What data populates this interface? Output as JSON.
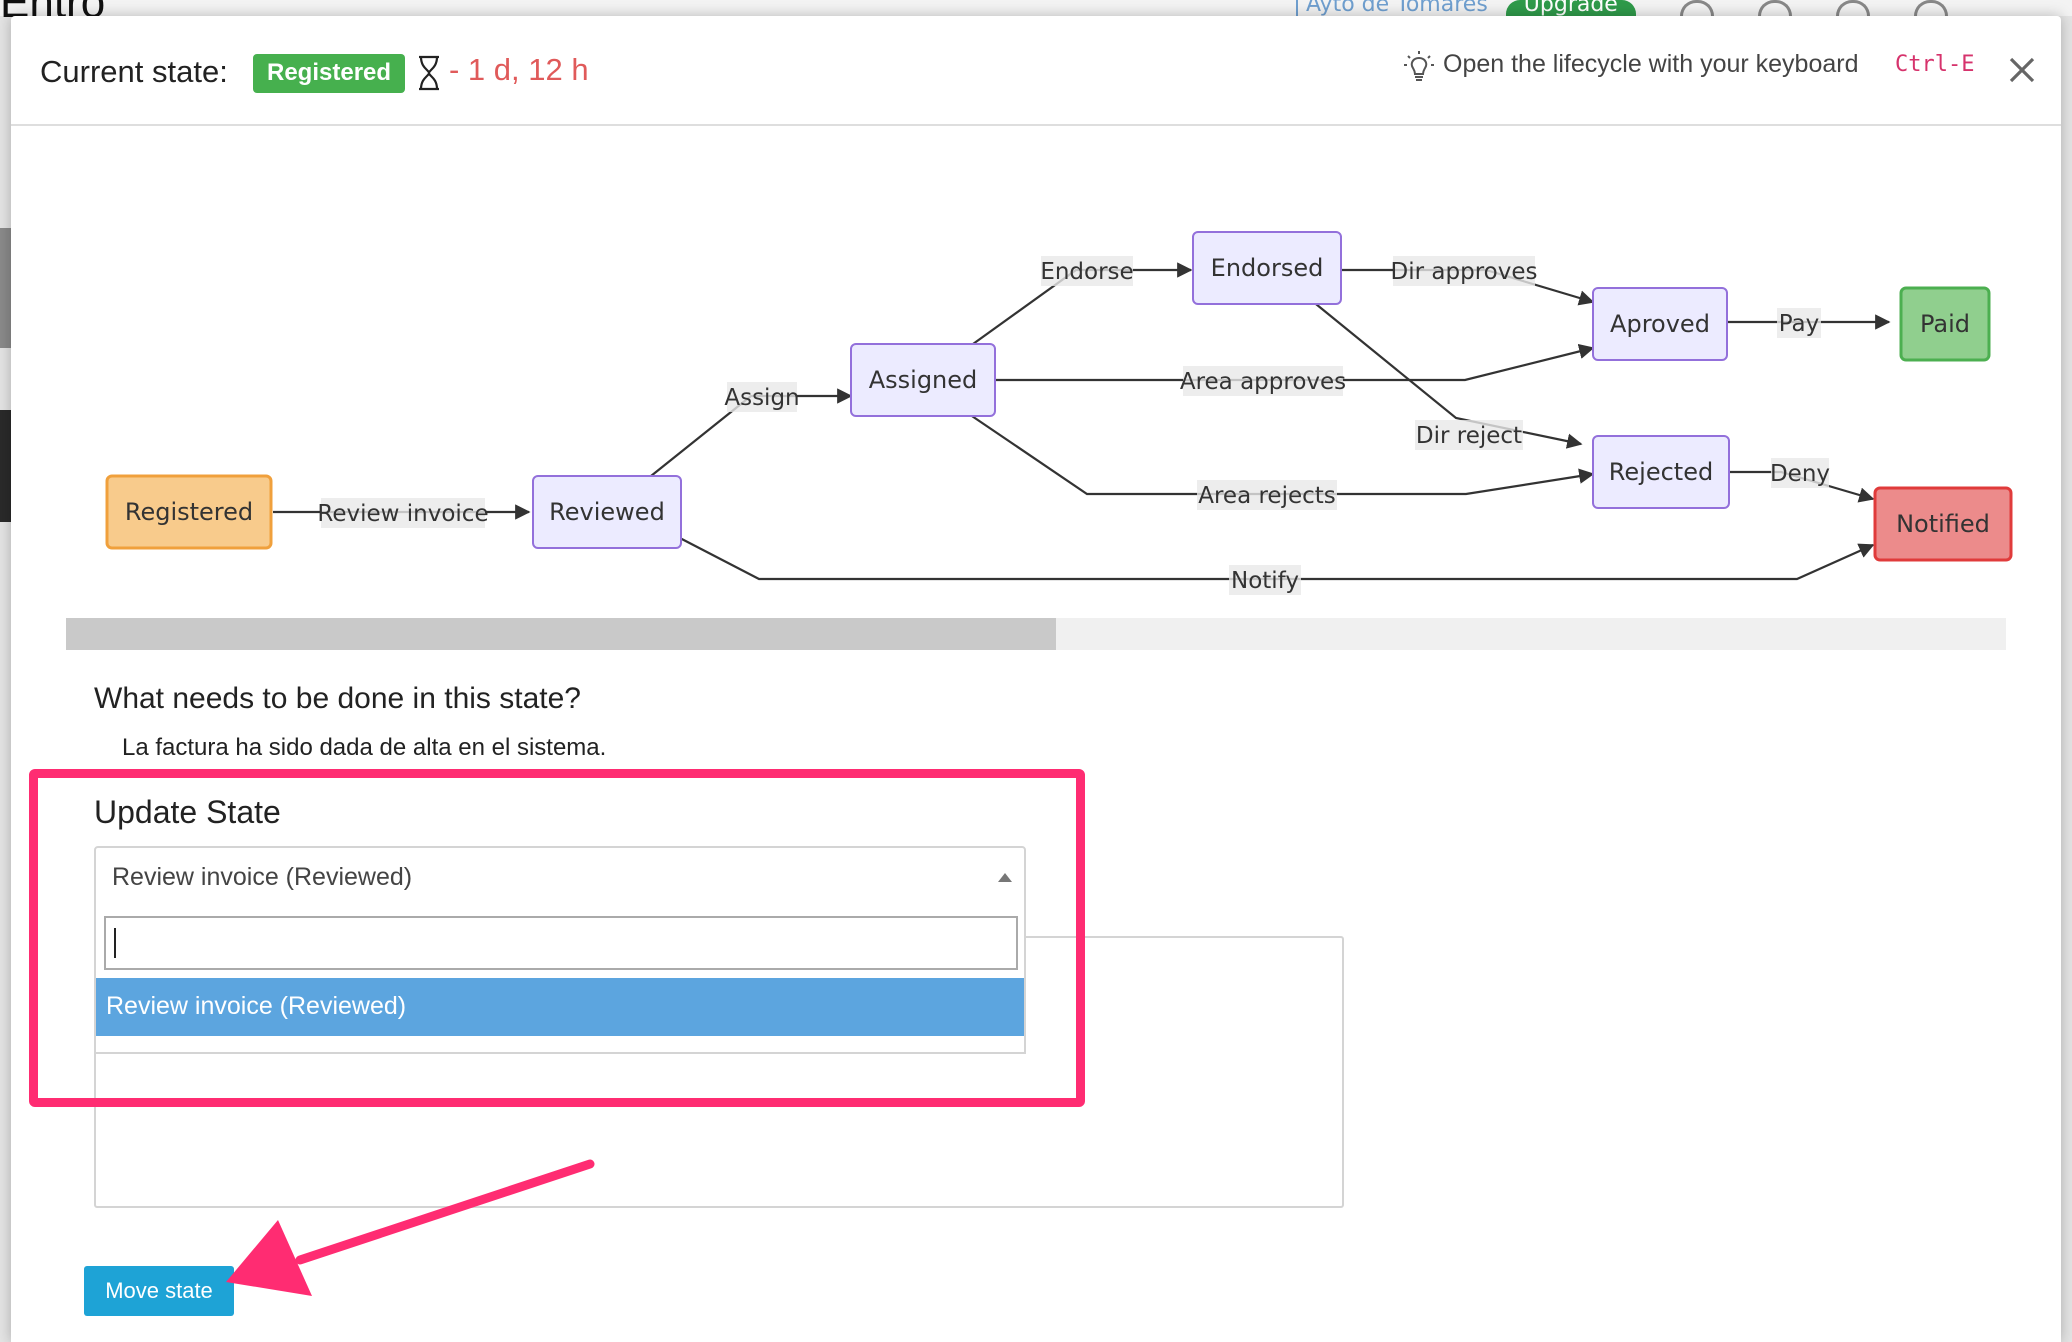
{
  "background": {
    "nav_link": "Ayto de Tomares",
    "upgrade_label": "Upgrade"
  },
  "header": {
    "current_state_label": "Current state:",
    "state_badge": "Registered",
    "elapsed_time": "- 1 d, 12 h",
    "tip_text": "Open the lifecycle with your keyboard",
    "shortcut": "Ctrl-E"
  },
  "diagram": {
    "nodes": {
      "registered": "Registered",
      "reviewed": "Reviewed",
      "assigned": "Assigned",
      "endorsed": "Endorsed",
      "aproved": "Aproved",
      "paid": "Paid",
      "rejected": "Rejected",
      "notified": "Notified"
    },
    "edges": {
      "review_invoice": "Review invoice",
      "assign": "Assign",
      "endorse": "Endorse",
      "dir_approves": "Dir approves",
      "area_approves": "Area approves",
      "pay": "Pay",
      "dir_reject": "Dir reject",
      "area_rejects": "Area rejects",
      "deny": "Deny",
      "notify": "Notify"
    },
    "colors": {
      "registered_fill": "#f8cb8c",
      "registered_stroke": "#f0a03c",
      "default_fill": "#ecebff",
      "default_stroke": "#9370db",
      "paid_fill": "#90cf8e",
      "paid_stroke": "#4caf50",
      "notified_fill": "#ec8b8b",
      "notified_stroke": "#e03b3b"
    }
  },
  "state_info": {
    "title": "What needs to be done in this state?",
    "description": "La factura ha sido dada de alta en el sistema."
  },
  "update": {
    "title": "Update State",
    "selected_value": "Review invoice (Reviewed)",
    "search_value": "",
    "options": [
      "Review invoice (Reviewed)"
    ]
  },
  "actions": {
    "move_state_label": "Move state"
  },
  "annotation": {
    "color": "#ff2c72"
  }
}
